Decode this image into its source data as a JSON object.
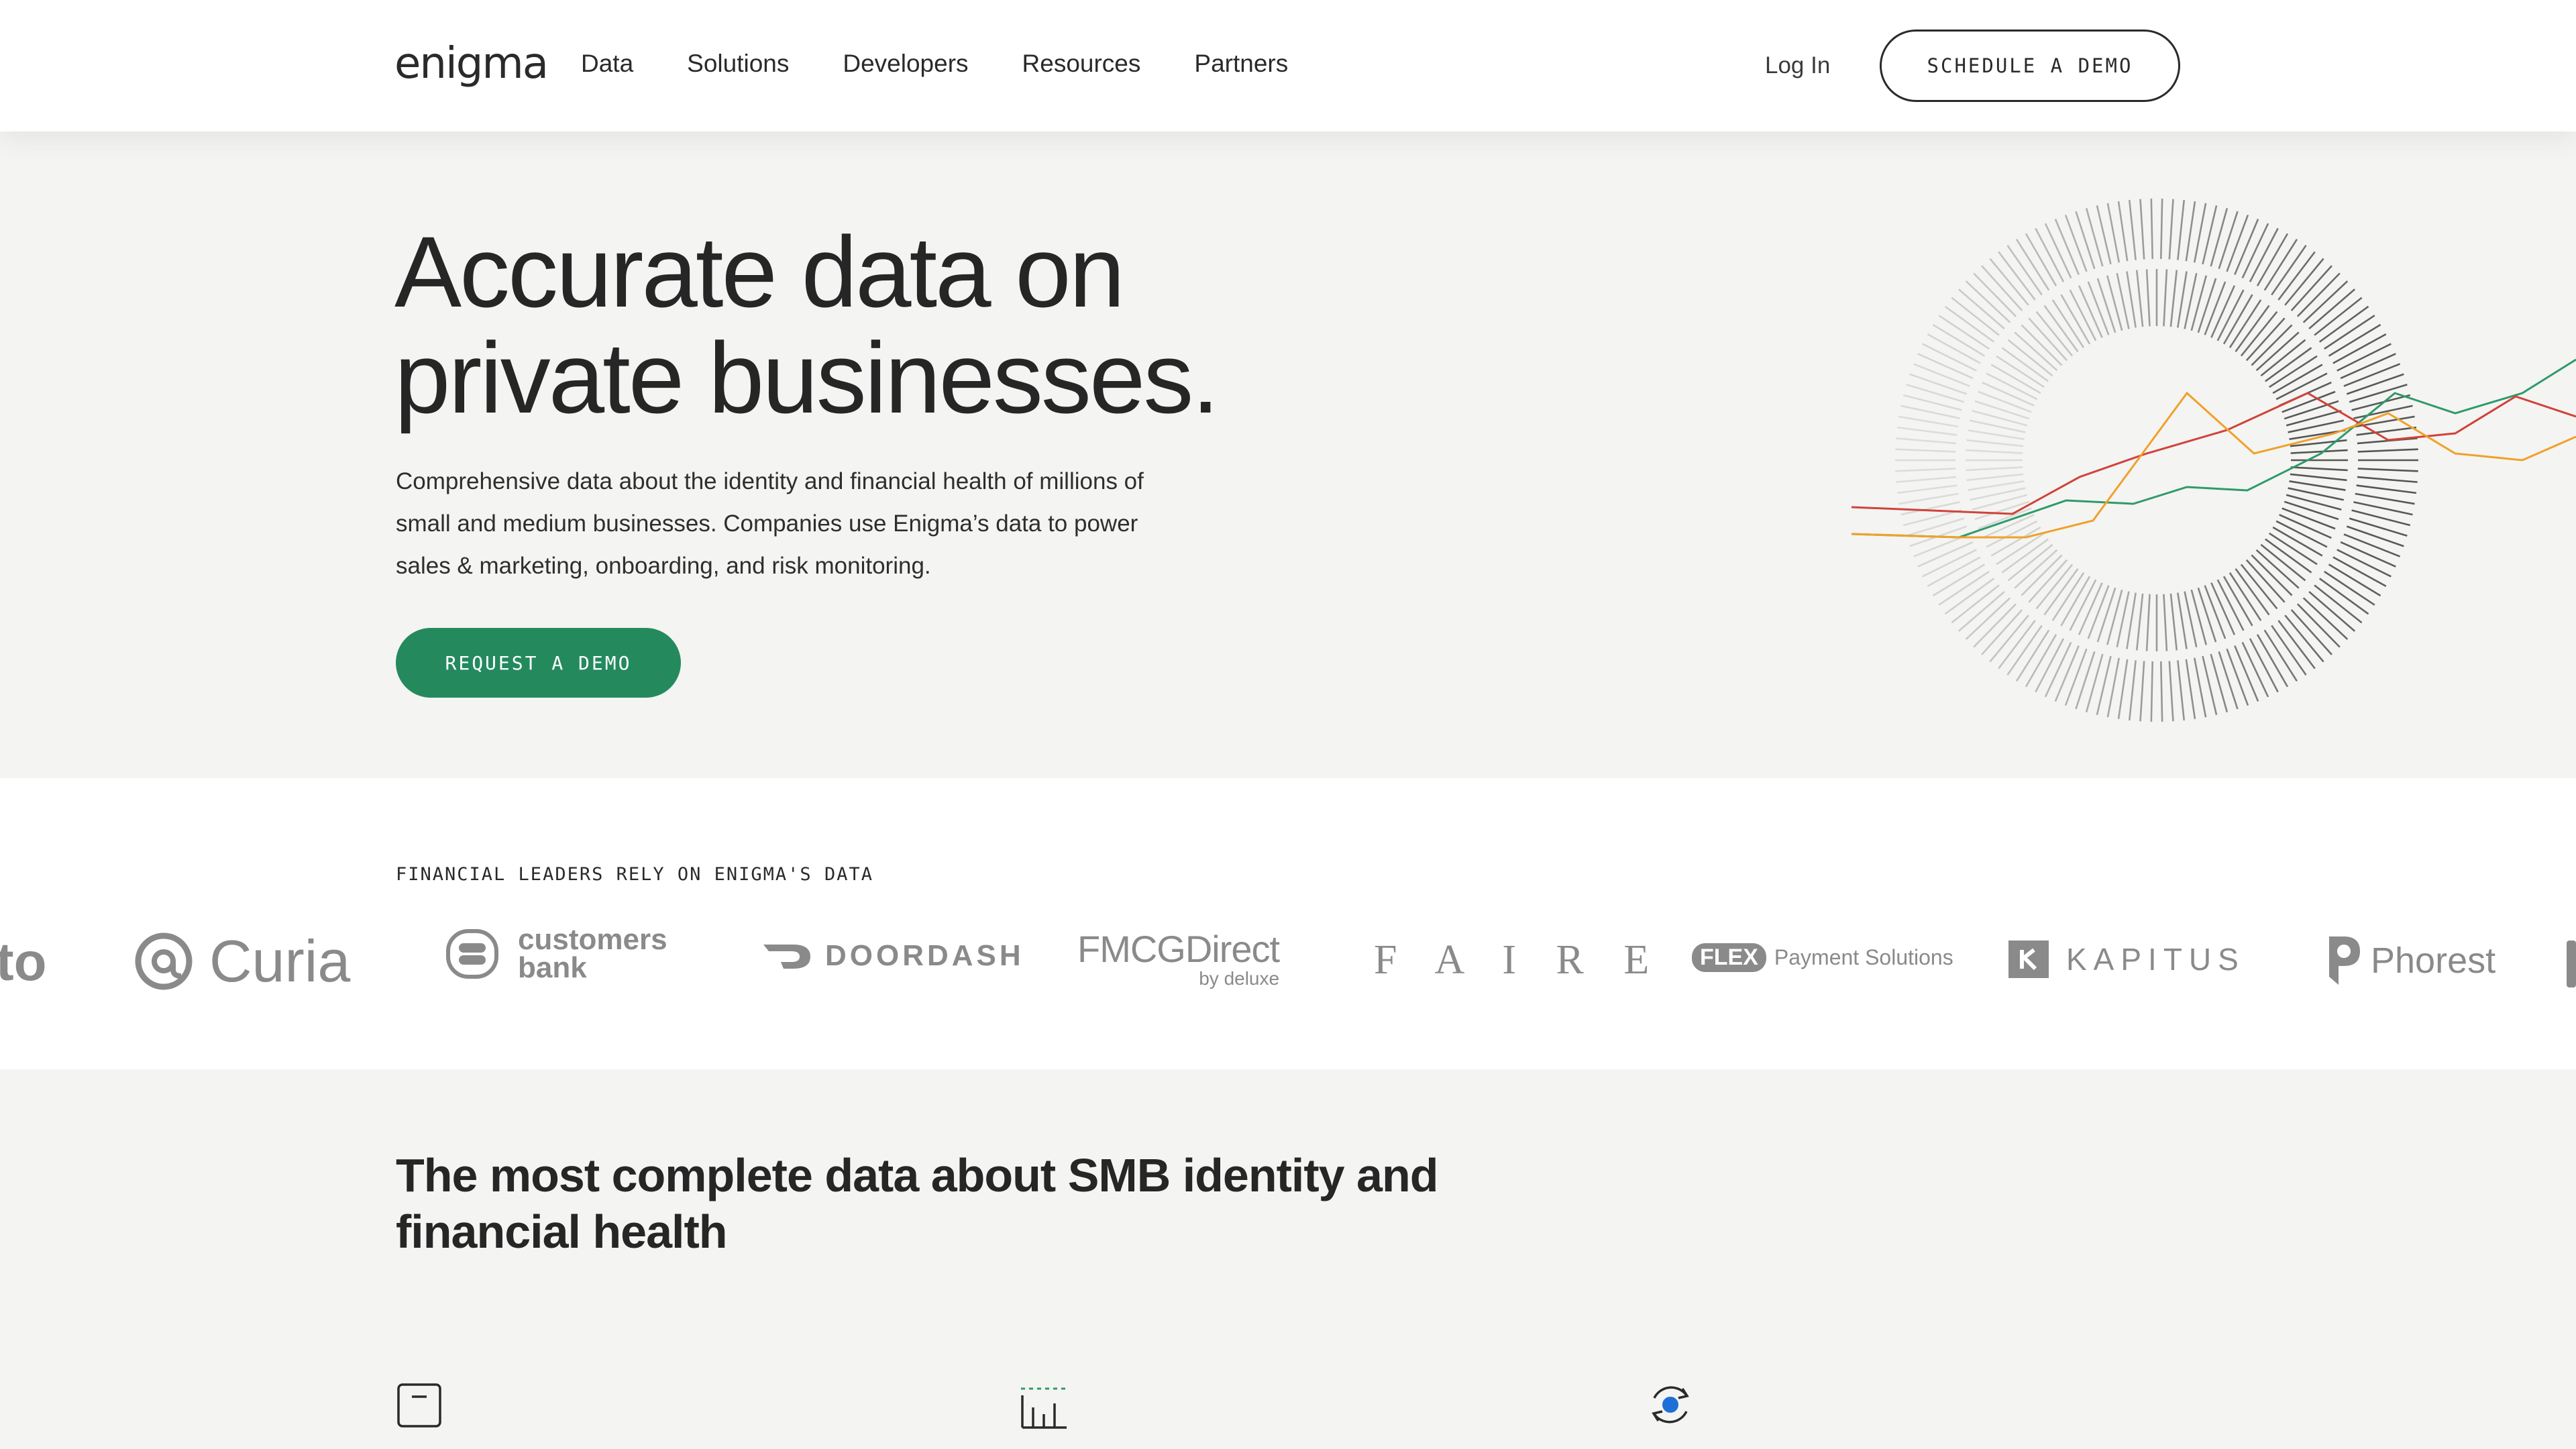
{
  "header": {
    "logo": "enigma",
    "nav": [
      "Data",
      "Solutions",
      "Developers",
      "Resources",
      "Partners"
    ],
    "login": "Log In",
    "cta": "SCHEDULE A DEMO"
  },
  "hero": {
    "title_line1": "Accurate data on",
    "title_line2": "private businesses.",
    "desc_line1": "Comprehensive data about the identity and financial health of millions of",
    "desc_line2": "small and medium businesses. Companies use Enigma’s data to power",
    "desc_line3": "sales & marketing, onboarding, and risk monitoring.",
    "cta": "REQUEST A DEMO"
  },
  "logos": {
    "label": "FINANCIAL LEADERS RELY ON ENIGMA'S DATA",
    "items": {
      "partial_left": "to",
      "curia": "Curia",
      "customers_1": "customers",
      "customers_2": "bank",
      "doordash": "DOORDASH",
      "fmcg": "FMCGDirect",
      "fmcg_sub": "by deluxe",
      "faire": "F A I R E",
      "flex_badge": "FLEX",
      "flex_text": "Payment Solutions",
      "kapitus": "KAPITUS",
      "phorest": "Phorest"
    }
  },
  "features": {
    "title_line1": "The most complete data about SMB identity and",
    "title_line2": "financial health",
    "icons": [
      "document-icon",
      "bar-chart-icon",
      "refresh-icon"
    ]
  },
  "colors": {
    "accent_green": "#248a5e",
    "line_green": "#2e9a6a",
    "line_red": "#d0433a",
    "line_orange": "#f0a12a",
    "dot_blue": "#1f6fd6"
  }
}
